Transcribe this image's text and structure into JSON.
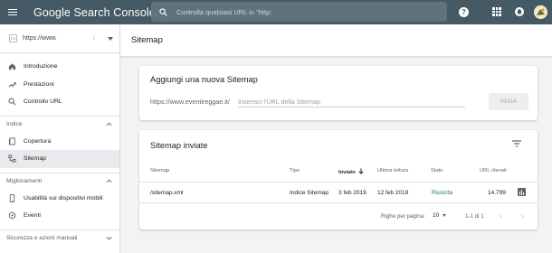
{
  "app": {
    "title": "Google Search Console",
    "search_placeholder": "Controlla qualsiasi URL in \"http:"
  },
  "sidebar": {
    "property": {
      "url": "https://www.",
      "separator": "/"
    },
    "items_top": [
      {
        "label": "Introduzione",
        "icon": "home-icon"
      },
      {
        "label": "Prestazioni",
        "icon": "trending-up-icon"
      },
      {
        "label": "Controllo URL",
        "icon": "search-icon"
      }
    ],
    "sections": [
      {
        "label": "Indice",
        "items": [
          {
            "label": "Copertura",
            "icon": "document-icon"
          },
          {
            "label": "Sitemap",
            "icon": "sitemap-icon",
            "active": true
          }
        ]
      },
      {
        "label": "Miglioramenti",
        "items": [
          {
            "label": "Usabilità sui dispositivi mobili",
            "icon": "phone-icon"
          },
          {
            "label": "Eventi",
            "icon": "event-icon"
          }
        ]
      },
      {
        "label": "Sicurezza e azioni manuali",
        "items": []
      }
    ]
  },
  "page": {
    "title": "Sitemap"
  },
  "add_sitemap": {
    "title": "Aggiungi una nuova Sitemap",
    "url_prefix": "https://www.eventireggae.it/",
    "input_placeholder": "Inserisci l'URL della Sitemap",
    "submit_label": "INVIA"
  },
  "submitted": {
    "title": "Sitemap inviate",
    "columns": [
      "Sitemap",
      "Tipo",
      "Inviato",
      "Ultima lettura",
      "Stato",
      "URL rilevati"
    ],
    "sorted_column": "Inviato",
    "rows": [
      {
        "sitemap": "/sitemap.xml",
        "tipo": "Indice Sitemap",
        "inviato": "3 feb 2019",
        "ultima_lettura": "12 feb 2019",
        "stato": "Riuscita",
        "url_rilevati": "14.799"
      }
    ],
    "footer": {
      "rows_per_page_label": "Righe per pagina:",
      "rows_per_page_value": "10",
      "range": "1-1 di 1"
    }
  },
  "colors": {
    "topbar": "#455a64",
    "success": "#188038",
    "active_nav": "#e8eaed"
  }
}
